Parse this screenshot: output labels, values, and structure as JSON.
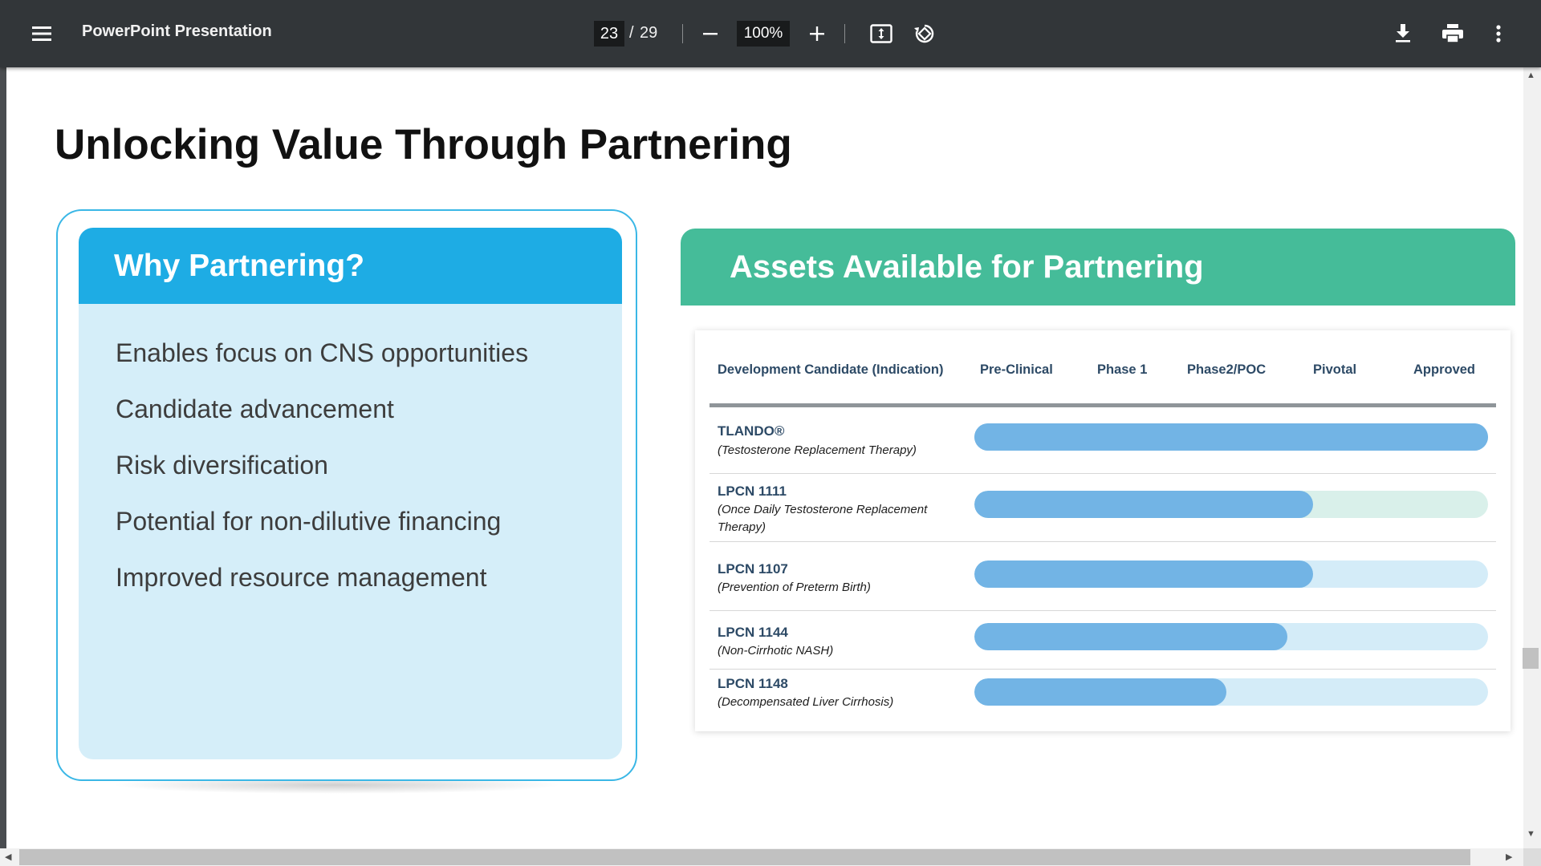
{
  "toolbar": {
    "title": "PowerPoint Presentation",
    "page_current": "23",
    "page_separator": "/",
    "page_total": "29",
    "zoom": "100%",
    "icons": [
      "menu-icon",
      "zoom-out-icon",
      "zoom-in-icon",
      "fit-to-page-icon",
      "rotate-icon",
      "download-icon",
      "print-icon",
      "more-vert-icon"
    ]
  },
  "slide": {
    "title": "Unlocking Value Through Partnering",
    "why": {
      "header": "Why Partnering?",
      "items": [
        "Enables focus on CNS opportunities",
        "Candidate advancement",
        "Risk diversification",
        "Potential for non-dilutive financing",
        "Improved resource management"
      ]
    },
    "assets": {
      "header": "Assets Available for Partnering",
      "columns": [
        "Development Candidate (Indication)",
        "Pre-Clinical",
        "Phase 1",
        "Phase2/POC",
        "Pivotal",
        "Approved"
      ],
      "rows": [
        {
          "name": "TLANDO®",
          "indication": "(Testosterone Replacement Therapy)",
          "progress": 1.0,
          "track_color": "#72b4e5"
        },
        {
          "name": "LPCN 1111",
          "indication": "(Once Daily Testosterone Replacement Therapy)",
          "progress": 0.66,
          "track_color": "#d9f0ea"
        },
        {
          "name": "LPCN 1107",
          "indication": "(Prevention of Preterm Birth)",
          "progress": 0.66,
          "track_color": "#d4ecf8"
        },
        {
          "name": "LPCN 1144",
          "indication": "(Non-Cirrhotic NASH)",
          "progress": 0.61,
          "track_color": "#d4ecf8"
        },
        {
          "name": "LPCN 1148",
          "indication": "(Decompensated Liver Cirrhosis)",
          "progress": 0.49,
          "track_color": "#d4ecf8"
        }
      ]
    }
  },
  "colors": {
    "toolbar": "#323639",
    "why_header": "#1eace4",
    "why_panel": "#d5eef9",
    "assets_header": "#45bc99",
    "bar_fill": "#72b4e5"
  }
}
